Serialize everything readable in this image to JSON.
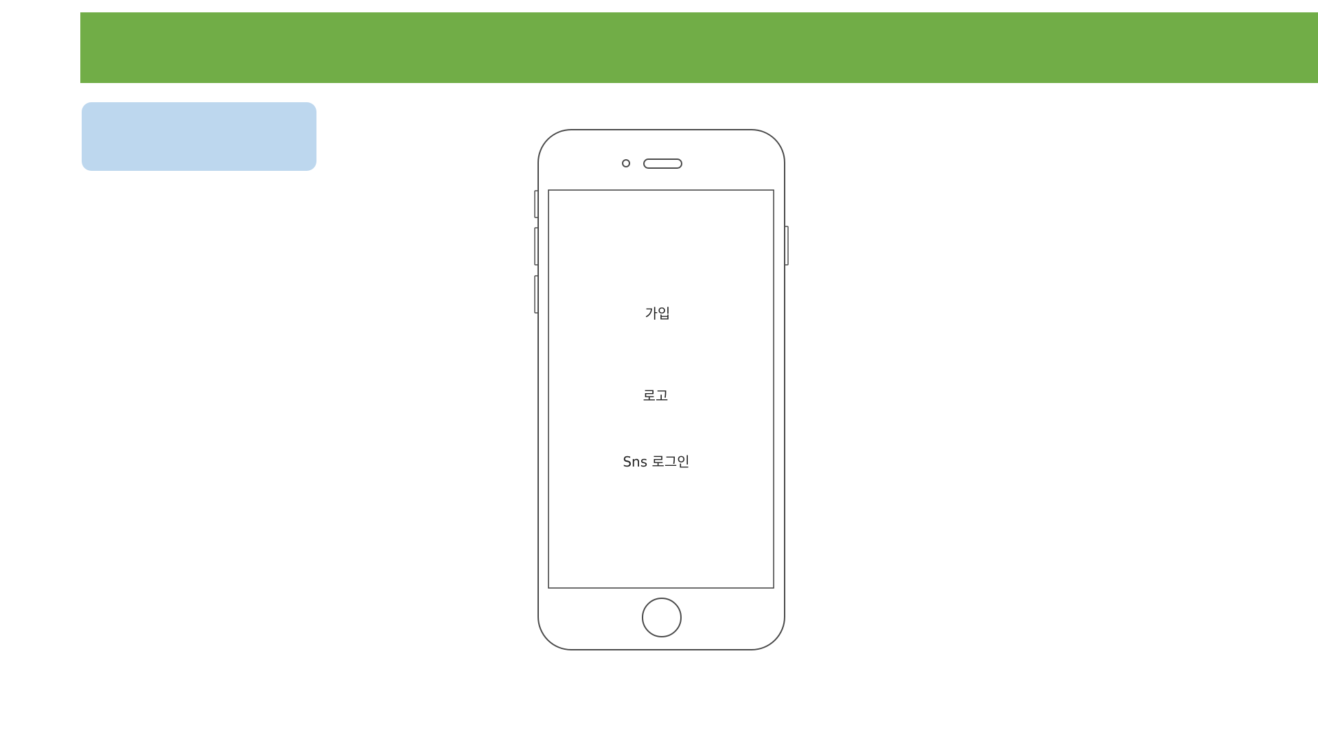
{
  "header": {
    "accent_color": "#71ad47"
  },
  "title_box": {
    "text": "",
    "color": "#bdd7ee"
  },
  "phone": {
    "screen": {
      "signup_label": "가입",
      "logo_label": "로고",
      "sns_login_label": "Sns 로그인"
    }
  }
}
